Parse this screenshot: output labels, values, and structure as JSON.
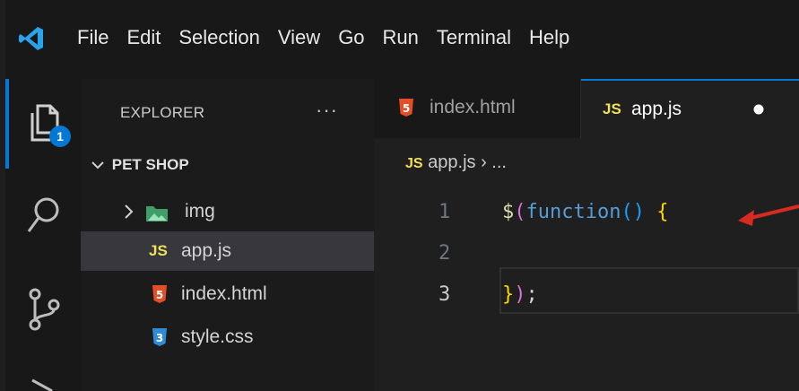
{
  "menu": [
    "File",
    "Edit",
    "Selection",
    "View",
    "Go",
    "Run",
    "Terminal",
    "Help"
  ],
  "activity": {
    "explorer_badge": "1"
  },
  "sidebar": {
    "title": "EXPLORER",
    "more": "···",
    "section": "PET SHOP",
    "items": [
      {
        "label": "img",
        "icon": "folder-image-icon"
      },
      {
        "label": "app.js",
        "icon": "js-icon",
        "badge": "JS",
        "selected": true
      },
      {
        "label": "index.html",
        "icon": "html-icon"
      },
      {
        "label": "style.css",
        "icon": "css-icon"
      }
    ]
  },
  "tabs": [
    {
      "label": "index.html",
      "icon": "html-icon"
    },
    {
      "label": "app.js",
      "badge": "JS",
      "active": true,
      "dirty": true
    }
  ],
  "breadcrumb": {
    "badge": "JS",
    "file": "app.js",
    "rest": "› ..."
  },
  "editor": {
    "line_numbers": [
      "1",
      "2",
      "3"
    ],
    "line1": {
      "dollar": "$",
      "paren": "(",
      "kw": "function",
      "args": "()",
      "brace": " {"
    },
    "line3": {
      "brace": "}",
      "paren": ")",
      "semi": ";"
    }
  },
  "colors": {
    "accent": "#0078d4",
    "js": "#f1e05a",
    "html": "#e44d26",
    "css": "#2f8bd8",
    "arrow": "#d72b1f"
  }
}
